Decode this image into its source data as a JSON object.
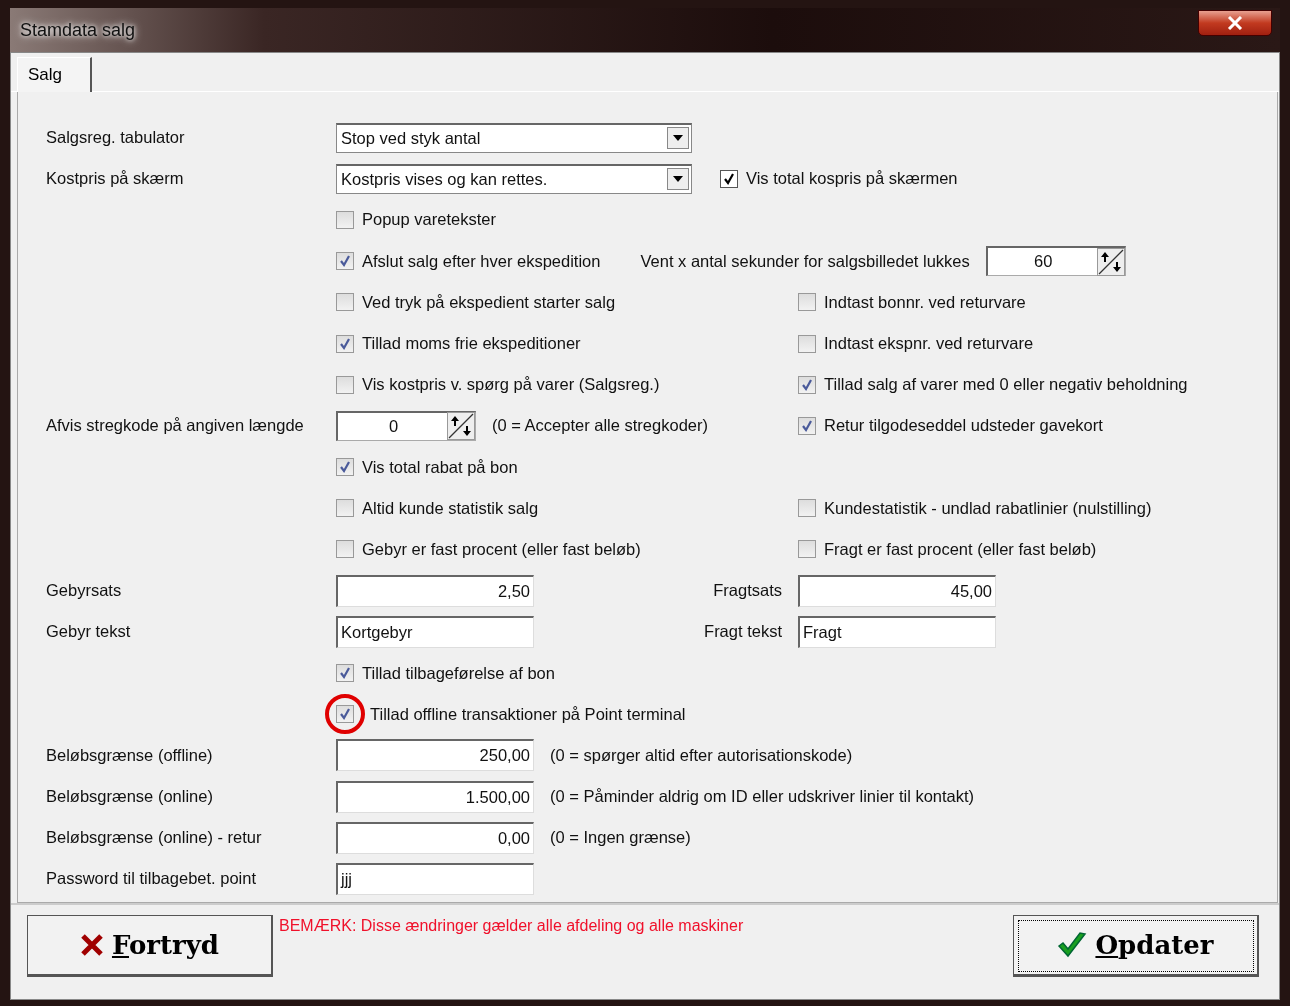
{
  "window": {
    "title": "Stamdata salg"
  },
  "tabs": [
    {
      "label": "Salg",
      "selected": true
    }
  ],
  "rows": [
    {
      "label": "Salgsreg. tabulator",
      "mid": [
        {
          "kind": "select",
          "value": "Stop ved styk antal"
        }
      ]
    },
    {
      "label": "Kostpris på skærm",
      "mid": [
        {
          "kind": "select",
          "value": "Kostpris vises og kan rettes."
        },
        {
          "kind": "classic_checkbox",
          "label": "Vis total kospris på skærmen",
          "checked": true
        }
      ]
    },
    {
      "mid": [
        {
          "kind": "checkbox",
          "label": "Popup varetekster",
          "checked": false
        }
      ]
    },
    {
      "mid": [
        {
          "kind": "checkbox",
          "label": "Afslut salg efter hver ekspedition",
          "checked": true
        },
        {
          "kind": "text",
          "text": "Vent x antal sekunder for salgsbilledet lukkes"
        },
        {
          "kind": "spin",
          "value": "60"
        }
      ]
    },
    {
      "mid": [
        {
          "kind": "checkbox",
          "label": "Ved tryk på ekspedient starter salg",
          "checked": false
        }
      ],
      "right": [
        {
          "kind": "checkbox",
          "label": "Indtast bonnr. ved returvare",
          "checked": false
        }
      ]
    },
    {
      "mid": [
        {
          "kind": "checkbox",
          "label": "Tillad moms frie ekspeditioner",
          "checked": true
        }
      ],
      "right": [
        {
          "kind": "checkbox",
          "label": "Indtast ekspnr. ved returvare",
          "checked": false
        }
      ]
    },
    {
      "mid": [
        {
          "kind": "checkbox",
          "label": "Vis kostpris v. spørg på varer (Salgsreg.)",
          "checked": false
        }
      ],
      "right": [
        {
          "kind": "checkbox",
          "label": "Tillad salg af varer med 0 eller negativ beholdning",
          "checked": true
        }
      ]
    },
    {
      "label": "Afvis stregkode på angiven længde",
      "mid": [
        {
          "kind": "spin",
          "value": "0"
        },
        {
          "kind": "text",
          "text": "(0 = Accepter alle stregkoder)"
        }
      ],
      "right": [
        {
          "kind": "checkbox",
          "label": "Retur tilgodeseddel udsteder gavekort",
          "checked": true
        }
      ]
    },
    {
      "mid": [
        {
          "kind": "checkbox",
          "label": "Vis total rabat på bon",
          "checked": true
        }
      ]
    },
    {
      "mid": [
        {
          "kind": "checkbox",
          "label": "Altid kunde statistik salg",
          "checked": false
        }
      ],
      "right": [
        {
          "kind": "checkbox",
          "label": "Kundestatistik - undlad rabatlinier (nulstilling)",
          "checked": false
        }
      ]
    },
    {
      "mid": [
        {
          "kind": "checkbox",
          "label": "Gebyr er fast procent (eller fast beløb)",
          "checked": false
        }
      ],
      "right": [
        {
          "kind": "checkbox",
          "label": "Fragt er fast procent (eller fast beløb)",
          "checked": false
        }
      ]
    },
    {
      "label": "Gebyrsats",
      "mid": [
        {
          "kind": "number_field",
          "value": "2,50"
        },
        {
          "kind": "sublabel",
          "text": "Fragtsats"
        }
      ],
      "right": [
        {
          "kind": "number_field",
          "value": "45,00"
        }
      ]
    },
    {
      "label": "Gebyr tekst",
      "mid": [
        {
          "kind": "text_field",
          "value": "Kortgebyr"
        },
        {
          "kind": "sublabel",
          "text": "Fragt tekst"
        }
      ],
      "right": [
        {
          "kind": "text_field",
          "value": "Fragt"
        }
      ]
    },
    {
      "mid": [
        {
          "kind": "checkbox",
          "label": "Tillad tilbageførelse af bon",
          "checked": true
        }
      ]
    },
    {
      "mid": [
        {
          "kind": "checkbox",
          "label": "Tillad offline transaktioner på Point terminal",
          "checked": true,
          "highlighted": true
        }
      ]
    },
    {
      "label": "Beløbsgrænse (offline)",
      "mid": [
        {
          "kind": "number_field",
          "value": "250,00"
        },
        {
          "kind": "text",
          "text": "(0 = spørger altid efter autorisationskode)"
        }
      ]
    },
    {
      "label": "Beløbsgrænse (online)",
      "mid": [
        {
          "kind": "number_field",
          "value": "1.500,00"
        },
        {
          "kind": "text",
          "text": "(0 = Påminder aldrig om ID eller udskriver linier til kontakt)"
        }
      ]
    },
    {
      "label": "Beløbsgrænse (online) - retur",
      "mid": [
        {
          "kind": "number_field",
          "value": "0,00"
        },
        {
          "kind": "text",
          "text": "(0 = Ingen grænse)"
        }
      ]
    },
    {
      "label": "Password til tilbagebet. point",
      "mid": [
        {
          "kind": "text_field",
          "value": "jjj"
        }
      ]
    }
  ],
  "footer": {
    "cancel": "Fortryd",
    "notice": "BEMÆRK: Disse ændringer gælder alle afdeling og alle maskiner",
    "update": "Opdater"
  }
}
